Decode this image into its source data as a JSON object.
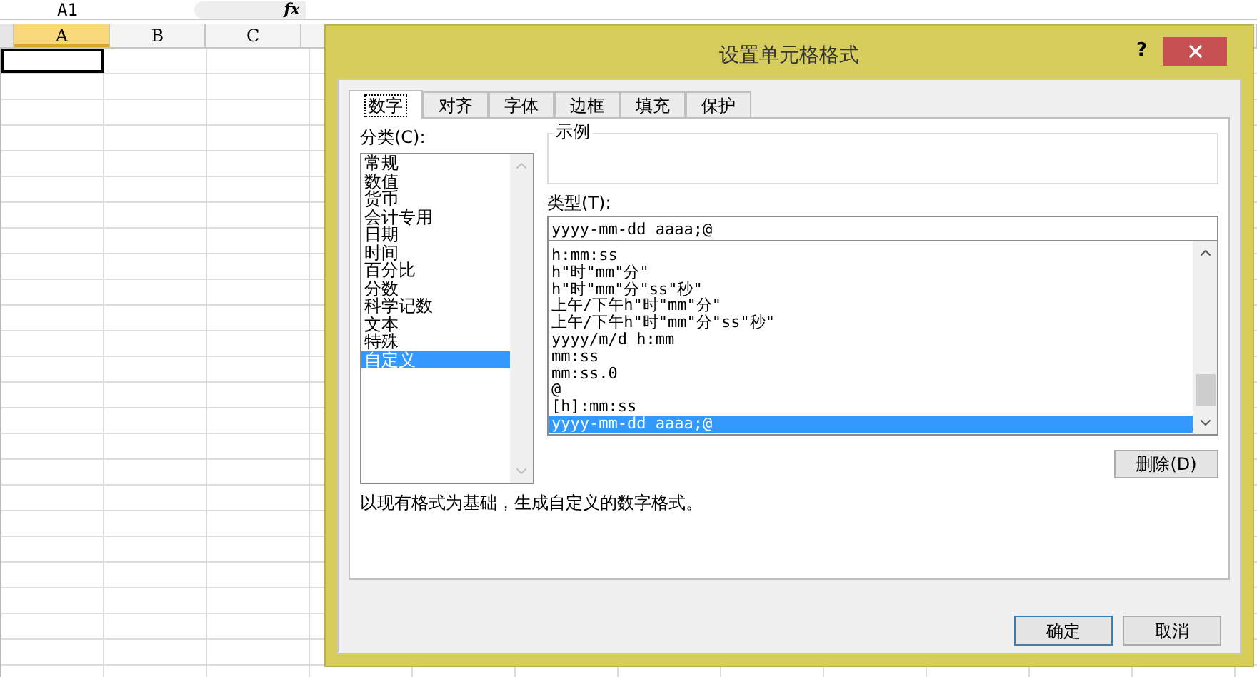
{
  "formula_bar": {
    "name_box": "A1",
    "fx": "fx"
  },
  "sheet": {
    "columns": [
      {
        "label": "A",
        "selected": true
      },
      {
        "label": "B",
        "selected": false
      },
      {
        "label": "C",
        "selected": false
      }
    ]
  },
  "dialog": {
    "title": "设置单元格格式",
    "help": "?",
    "tabs": [
      {
        "label": "数字",
        "selected": true
      },
      {
        "label": "对齐",
        "selected": false
      },
      {
        "label": "字体",
        "selected": false
      },
      {
        "label": "边框",
        "selected": false
      },
      {
        "label": "填充",
        "selected": false
      },
      {
        "label": "保护",
        "selected": false
      }
    ],
    "category_label": "分类(C):",
    "categories": [
      {
        "label": "常规",
        "selected": false
      },
      {
        "label": "数值",
        "selected": false
      },
      {
        "label": "货币",
        "selected": false
      },
      {
        "label": "会计专用",
        "selected": false
      },
      {
        "label": "日期",
        "selected": false
      },
      {
        "label": "时间",
        "selected": false
      },
      {
        "label": "百分比",
        "selected": false
      },
      {
        "label": "分数",
        "selected": false
      },
      {
        "label": "科学记数",
        "selected": false
      },
      {
        "label": "文本",
        "selected": false
      },
      {
        "label": "特殊",
        "selected": false
      },
      {
        "label": "自定义",
        "selected": true
      }
    ],
    "sample_label": "示例",
    "type_label": "类型(T):",
    "type_value": "yyyy-mm-dd aaaa;@",
    "formats": [
      {
        "label": "h:mm:ss",
        "selected": false
      },
      {
        "label": "h\"时\"mm\"分\"",
        "selected": false
      },
      {
        "label": "h\"时\"mm\"分\"ss\"秒\"",
        "selected": false
      },
      {
        "label": "上午/下午h\"时\"mm\"分\"",
        "selected": false
      },
      {
        "label": "上午/下午h\"时\"mm\"分\"ss\"秒\"",
        "selected": false
      },
      {
        "label": "yyyy/m/d h:mm",
        "selected": false
      },
      {
        "label": "mm:ss",
        "selected": false
      },
      {
        "label": "mm:ss.0",
        "selected": false
      },
      {
        "label": "@",
        "selected": false
      },
      {
        "label": "[h]:mm:ss",
        "selected": false
      },
      {
        "label": "yyyy-mm-dd aaaa;@",
        "selected": true
      }
    ],
    "delete_button": "删除(D)",
    "description": "以现有格式为基础，生成自定义的数字格式。",
    "buttons": [
      {
        "label": "确定",
        "kind": "default"
      },
      {
        "label": "取消",
        "kind": "normal"
      }
    ]
  }
}
